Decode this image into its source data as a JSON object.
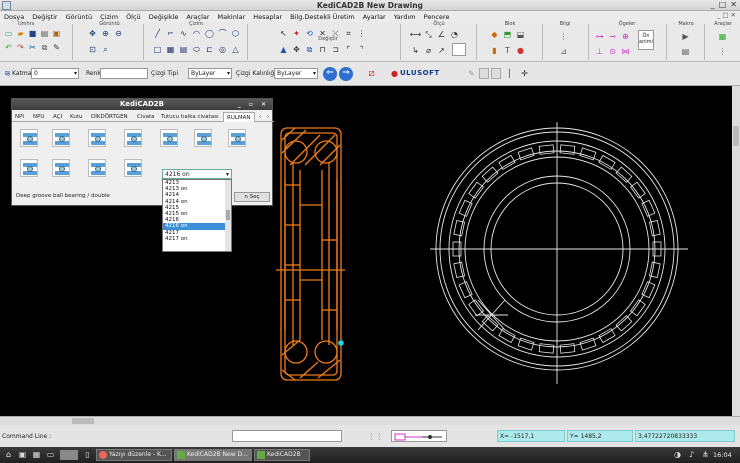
{
  "window": {
    "title": "KediCAD2B New Drawing",
    "controls": [
      "_",
      "□",
      "✕"
    ]
  },
  "menu": [
    "Dosya",
    "Değiştir",
    "Görüntü",
    "Çizim",
    "Ölçü",
    "Değişikle",
    "Araçlar",
    "Makinlar",
    "Hesaplar",
    "Bilg.Destekli Üretim",
    "Ayarlar",
    "Yardım",
    "Pencere"
  ],
  "ribbon_groups": [
    "Görüntü",
    "Çizim",
    "Değiştir",
    "Ölçü",
    "Blok",
    "Bilgi",
    "Ögeler",
    "Makro",
    "Araçlar"
  ],
  "ribbon_small": {
    "umhrs": "Umhrs",
    "on_anim": "Ön\nanimi"
  },
  "toolbar2": {
    "layer_label": "Katman",
    "layer_value": "0",
    "color_label": "Renk",
    "linetype_label": "Çizgi Tipi",
    "linetype_value": "ByLayer",
    "lineweight_label": "Çizgi Kalınlığı",
    "lineweight_value": "ByLayer",
    "logo_text": "ULUSOFT"
  },
  "dialog": {
    "title": "KediCAD2B",
    "tabs": [
      "NPI",
      "NPU",
      "AÇI",
      "Kutu",
      "DİKDÖRTGEN",
      "Civata",
      "Tutucu halka civatası",
      "RULMAN"
    ],
    "active_tab": "RULMAN",
    "selected_value": "4216 on",
    "footer": "Deep groove ball bearing / double",
    "button": "n Seç",
    "options": [
      "4213",
      "4213 on",
      "4214",
      "4214 on",
      "4215",
      "4215 on",
      "4216",
      "4216 on",
      "4217",
      "4217 on"
    ],
    "selected_index": 7
  },
  "status": {
    "command_label": "Command Line :",
    "x_coord": "X= -1517,1",
    "y_coord": "Y= 1485,2",
    "scale": "3,47722720833333"
  },
  "taskbar": {
    "items": [
      "Yazıyı düzenle - K...",
      "KediCAD2B New D...",
      "KediCAD2B"
    ],
    "clock": "16:04"
  },
  "colors": {
    "drawing_orange": "#f07d18",
    "drawing_white": "#e8e8e8",
    "cyan_point": "#22d5e0",
    "coord_bg": "#aeeaec"
  }
}
